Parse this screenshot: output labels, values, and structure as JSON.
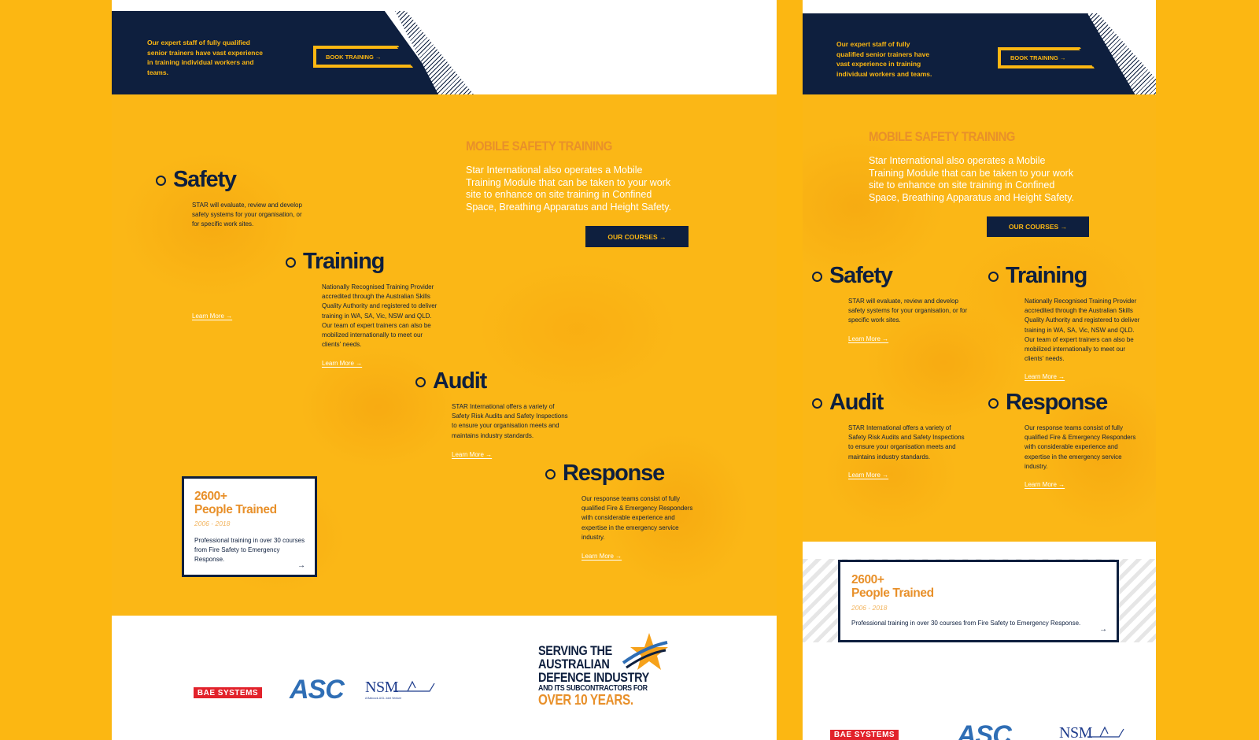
{
  "header": {
    "intro": "Our expert staff of fully qualified senior trainers have vast experience in training individual workers and teams.",
    "book_label": "BOOK TRAINING →"
  },
  "mobile": {
    "title": "MOBILE SAFETY TRAINING",
    "text": "Star International also operates a Mobile Training Module that can be taken to your work site to enhance on site training in Confined Space, Breathing Apparatus and Height Safety.",
    "courses_label": "OUR COURSES →"
  },
  "services": [
    {
      "title": "Safety",
      "text": "STAR will evaluate, review and develop safety systems for your organisation, or for specific work sites.",
      "link": "Learn More →"
    },
    {
      "title": "Training",
      "text": "Nationally Recognised Training Provider accredited through the Australian Skills Quality Authority and registered to deliver training in WA, SA, Vic, NSW and QLD. Our team of expert trainers can also be mobilized internationally to meet our clients' needs.",
      "link": "Learn More →"
    },
    {
      "title": "Audit",
      "text": "STAR International offers a variety of Safety Risk Audits and Safety Inspections to ensure your organisation meets and maintains industry standards.",
      "link": "Learn More →"
    },
    {
      "title": "Response",
      "text": "Our response teams consist of fully qualified Fire & Emergency Responders with considerable experience and expertise in the emergency service industry.",
      "link": "Learn More →"
    }
  ],
  "stat": {
    "count": "2600+",
    "label": "People Trained",
    "years": "2006 - 2018",
    "desc": "Professional training in over 30 courses from Fire Safety to Emergency Response.",
    "arrow": "→"
  },
  "logos": {
    "bae": "BAE SYSTEMS",
    "asc": "ASC",
    "nsm": "NSM",
    "nsm_sub": "A Babcock-UGL Joint Venture"
  },
  "serving": {
    "line1": "SERVING THE",
    "line2": "AUSTRALIAN",
    "line3": "DEFENCE INDUSTRY",
    "line4": "AND ITS SUBCONTRACTORS FOR",
    "line5": "OVER 10 YEARS."
  },
  "colors": {
    "navy": "#0E1F3E",
    "yellow": "#FCB712",
    "orange": "#E8902A"
  }
}
